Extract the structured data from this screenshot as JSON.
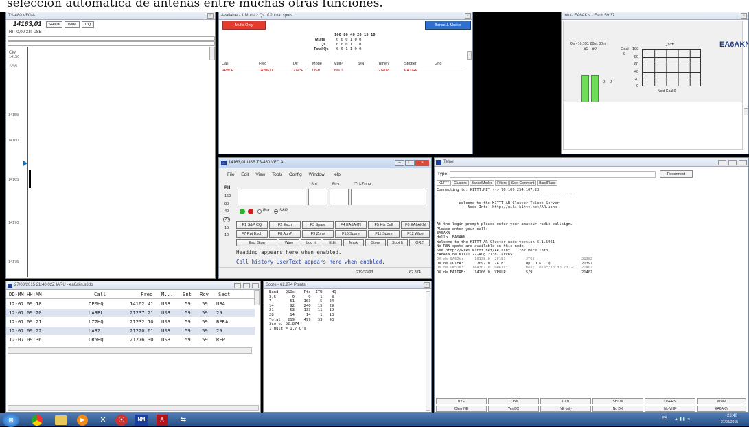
{
  "caption": "selección automática de antenas entre muchas otras funciones.",
  "bandmap": {
    "title": "TS-480 VFO A",
    "freq": "14163,01",
    "buttons": [
      "SHIDX",
      "Wide",
      "CQ"
    ],
    "rit": "RIT 0,00 XIT USB",
    "mode_cw": "CW",
    "freq_cw": "14150",
    "mode_ssb": "SSB",
    "ticks": [
      "14155",
      "14160",
      "14165",
      "14170",
      "14175"
    ]
  },
  "available": {
    "title": "Available - 1 Mults 2 Qs of 2 total spots",
    "mults_only": "Mults Only",
    "bands_modes": "Bands & Modes",
    "bands_header": "160 80 40 20 15 10",
    "stats": [
      {
        "label": "Mults",
        "values": "0 0 0 1 0 0"
      },
      {
        "label": "Qs",
        "values": "0 0 0 1 1 0"
      },
      {
        "label": "Total Qs",
        "values": "0 0 1 1 0 0"
      }
    ],
    "columns": [
      "Call",
      "Freq",
      "Dir",
      "Mode",
      "Mult?",
      "S/N",
      "Time v",
      "Spotter",
      "Grid"
    ],
    "spot": [
      "VP8LP",
      "14206,0",
      "214*H",
      "USB",
      "Yes 1",
      "",
      "2140Z",
      "EA1IRE",
      ""
    ]
  },
  "info": {
    "title": "Info - EA6AKN - Esch 59 37",
    "gauge_label": "Q's - 10,100, 80m, 30m",
    "bar1": "60",
    "bar2": "60",
    "goal": "Goal",
    "goal_val": "0",
    "zero1": "0",
    "zero2": "0",
    "qs_hr": "Q's/Hr",
    "callsign": "EA6AKN",
    "yticks": [
      "100",
      "80",
      "60",
      "40",
      "20",
      "0"
    ],
    "next_goal": "Next Goal 0"
  },
  "entry": {
    "title": "14163,01 USB TS-480 VFO A",
    "menu": [
      "File",
      "Edit",
      "View",
      "Tools",
      "Config",
      "Window",
      "Help"
    ],
    "snt": "Snt",
    "rcv": "Rcv",
    "itu": "ITU-Zone",
    "side": [
      "PH",
      "160",
      "80",
      "40",
      "20",
      "15",
      "10"
    ],
    "run": "Run",
    "sp": "S&P",
    "fkeys1": [
      "F1 S&P CQ",
      "F2 Exch",
      "F3 Spare",
      "F4 EA6AKN",
      "F5 His Call",
      "F6 EA6AKN"
    ],
    "fkeys2": [
      "F7 Rpt Exch",
      "F8 Agn?",
      "F9 Zone",
      "F10 Spare",
      "F11 Spare",
      "F12 Wipe"
    ],
    "fkeys3": [
      "Esc: Stop",
      "Wipe",
      "Log It",
      "Edit",
      "Mark",
      "Store",
      "Spot It",
      "QRZ"
    ],
    "heading": "Heading appears here when enabled.",
    "history": "Call history UserText appears here when enabled.",
    "status1": "219/33/93",
    "status2": "62.874"
  },
  "telnet": {
    "title": "Telnet",
    "type_label": "Type:",
    "reconnect": "Reconnect",
    "tabs": [
      "K1TTT",
      "Clusters",
      "Bands/Modes",
      "Filters",
      "Spot Comment",
      "BandPlans"
    ],
    "lines": [
      "Connecting to: K1TTT.NET --> 70.109.254.107:23",
      "-------------------------------------------------------------",
      "",
      "          Welcome to the K1TTT AR-Cluster Telnet Server",
      "              Node Info: http://wiki.k1ttt.net/AR.ashx",
      "",
      "",
      "-------------------------------------------------------------",
      "At the login prompt please enter your amateur radio callsign.",
      "Please enter your call:",
      "EA6AKN",
      "Hello  EA6AKN",
      "Welcome to the K1TTT AR-Cluster node version 6.1.5061",
      "No RBN spots are available on this node.",
      "See http://wiki.k1ttt.net/AR.ashx    for more info.",
      "EA6AKN de K1TTT 27-Aug 2138Z arc6>",
      "DX de 9A6ZV:     10138.0  2F1E3         JT65                     2138Z",
      "DX de DG1EA:      7097.0  ZA1E          Op. DIK  CQ              2139Z",
      "DX de DK5DK:    144362.0  GW6ILY        best 10sec/13 db 73 GL   2140Z",
      "DX de EA1IRE:    14206.0  VP8LP         5/9                      2140Z"
    ],
    "btns1": [
      "BYE",
      "CONN",
      "DXN",
      "SHIDX",
      "USERS",
      "WWV"
    ],
    "btns2": [
      "Clear NE",
      "Yes DX",
      "NE only",
      "No DX",
      "No VHF",
      "EA6AKN"
    ]
  },
  "log": {
    "title": "27/08/2015 21:40:02Z IARU - ea6akn.s3db",
    "columns": [
      "DD-MM HH:MM",
      "Call",
      "Freq",
      "M...",
      "Snt",
      "Rcv",
      "Sect"
    ],
    "rows": [
      [
        "12-07 09:18",
        "OP0HQ",
        "14162,41",
        "USB",
        "59",
        "59",
        "UBA"
      ],
      [
        "12-07 09:20",
        "UA3BL",
        "21237,21",
        "USB",
        "59",
        "59",
        "29"
      ],
      [
        "12-07 09:21",
        "LZ7HQ",
        "21232,10",
        "USB",
        "59",
        "59",
        "BFRA"
      ],
      [
        "12-07 09:22",
        "UA3Z",
        "21220,61",
        "USB",
        "59",
        "59",
        "29"
      ],
      [
        "12-07 09:36",
        "CR5HQ",
        "21276,30",
        "USB",
        "59",
        "59",
        "REP"
      ]
    ]
  },
  "score": {
    "title": "Score - 62.874 Points",
    "lines": [
      "Band   QSOs    Pts  ITU    HQ",
      "3,5       9      9    1    8",
      "7        51    103    5   24",
      "14       92    240   15   29",
      "21       53    133   11   19",
      "28       14     14    1   13",
      "Total   219    499   33   93",
      "Score: 62.874",
      "1 Mult = 1,7 Q's"
    ]
  },
  "taskbar": {
    "tray_lang": "ES",
    "clock": "23:40",
    "date": "27/08/2015",
    "icons": [
      "windows-start",
      "chrome",
      "explorer",
      "media-player",
      "ham-radio",
      "radar-app",
      "n1mm",
      "acrobat",
      "network-app"
    ]
  }
}
